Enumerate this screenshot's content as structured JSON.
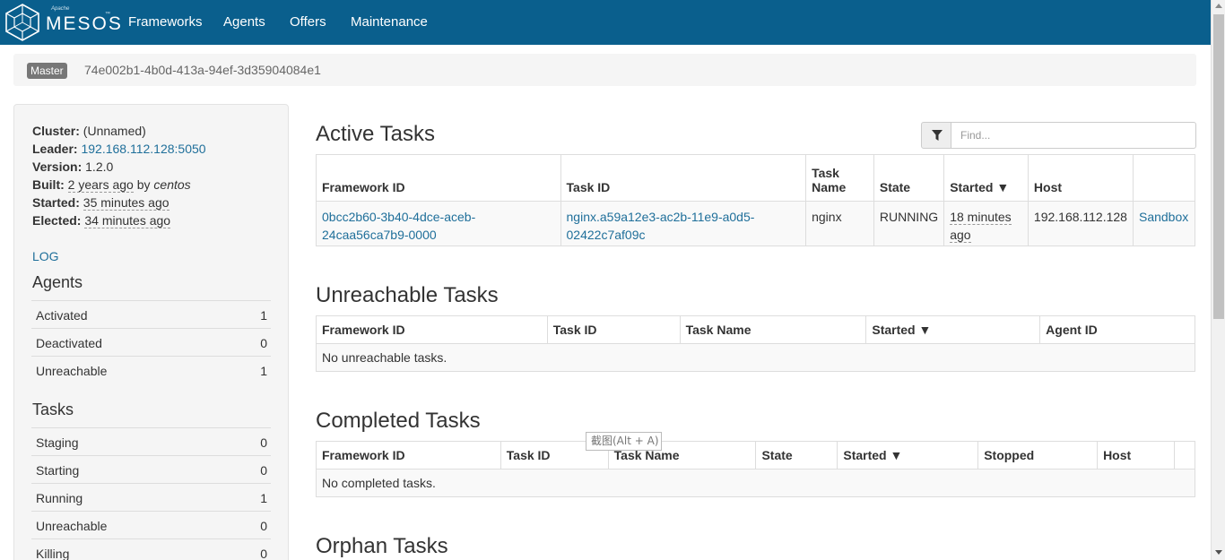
{
  "brand": {
    "apache": "Apache",
    "name": "MESOS",
    "tm": "™"
  },
  "nav": {
    "items": [
      {
        "label": "Frameworks"
      },
      {
        "label": "Agents"
      },
      {
        "label": "Offers"
      },
      {
        "label": "Maintenance"
      }
    ]
  },
  "breadcrumb": {
    "badge": "Master",
    "id": "74e002b1-4b0d-413a-94ef-3d35904084e1"
  },
  "sidebar": {
    "cluster_label": "Cluster:",
    "cluster_value": "(Unnamed)",
    "leader_label": "Leader:",
    "leader_value": "192.168.112.128:5050",
    "version_label": "Version:",
    "version_value": "1.2.0",
    "built_label": "Built:",
    "built_value": "2 years ago",
    "built_by": " by ",
    "built_user": "centos",
    "started_label": "Started:",
    "started_value": "35 minutes ago",
    "elected_label": "Elected:",
    "elected_value": "34 minutes ago",
    "log": "LOG",
    "agents_heading": "Agents",
    "agents": [
      {
        "label": "Activated",
        "value": "1"
      },
      {
        "label": "Deactivated",
        "value": "0"
      },
      {
        "label": "Unreachable",
        "value": "1"
      }
    ],
    "tasks_heading": "Tasks",
    "tasks": [
      {
        "label": "Staging",
        "value": "0"
      },
      {
        "label": "Starting",
        "value": "0"
      },
      {
        "label": "Running",
        "value": "1"
      },
      {
        "label": "Unreachable",
        "value": "0"
      },
      {
        "label": "Killing",
        "value": "0"
      }
    ]
  },
  "active": {
    "title": "Active Tasks",
    "filter_placeholder": "Find...",
    "headers": [
      "Framework ID",
      "Task ID",
      "Task Name",
      "State",
      "Started ▼",
      "Host",
      ""
    ],
    "rows": [
      {
        "framework_id": "0bcc2b60-3b40-4dce-aceb-24caa56ca7b9-0000",
        "task_id": "nginx.a59a12e3-ac2b-11e9-a0d5-02422c7af09c",
        "task_name": "nginx",
        "state": "RUNNING",
        "started": "18 minutes ago",
        "host": "192.168.112.128",
        "sandbox": "Sandbox"
      }
    ]
  },
  "unreachable": {
    "title": "Unreachable Tasks",
    "headers": [
      "Framework ID",
      "Task ID",
      "Task Name",
      "Started ▼",
      "Agent ID"
    ],
    "empty": "No unreachable tasks."
  },
  "completed": {
    "title": "Completed Tasks",
    "headers": [
      "Framework ID",
      "Task ID",
      "Task Name",
      "State",
      "Started ▼",
      "Stopped",
      "Host",
      ""
    ],
    "empty": "No completed tasks."
  },
  "orphan": {
    "title": "Orphan Tasks"
  },
  "tooltip": "截图(Alt + A)"
}
